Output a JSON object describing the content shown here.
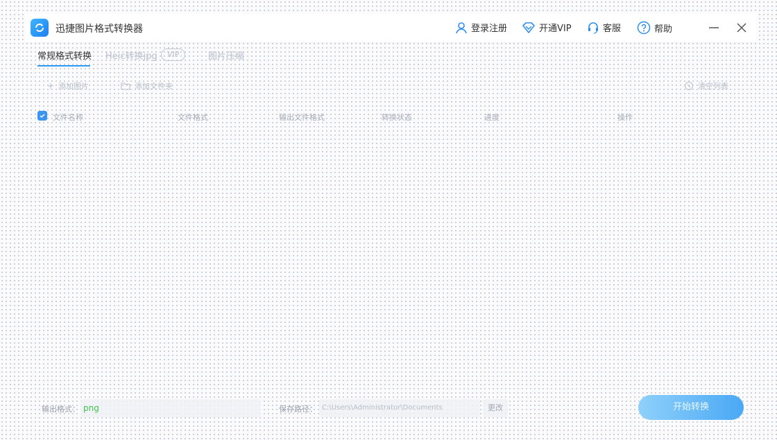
{
  "app": {
    "title": "迅捷图片格式转换器"
  },
  "topnav": {
    "login_label": "登录注册",
    "vip_label": "开通VIP",
    "service_label": "客服",
    "help_label": "帮助"
  },
  "tabs": [
    {
      "label": "常规格式转换"
    },
    {
      "label": "Heic转换jpg"
    },
    {
      "label": "图片压缩"
    }
  ],
  "vip_badge": "VIP",
  "toolbar": {
    "add_image_label": "添加图片",
    "add_folder_label": "添加文件夹",
    "clear_list_label": "清空列表"
  },
  "table": {
    "columns": [
      "文件名称",
      "文件格式",
      "输出文件格式",
      "转换状态",
      "进度",
      "操作"
    ]
  },
  "bottom": {
    "output_format_label": "输出格式：",
    "output_format_value": "png",
    "save_path_label": "保存路径：",
    "save_path_value": "C:\\Users\\Administrator\\Documents",
    "change_label": "更改",
    "start_label": "开始转换"
  },
  "colors": {
    "accent": "#2c9bf5",
    "format_value": "#3cc24a"
  }
}
